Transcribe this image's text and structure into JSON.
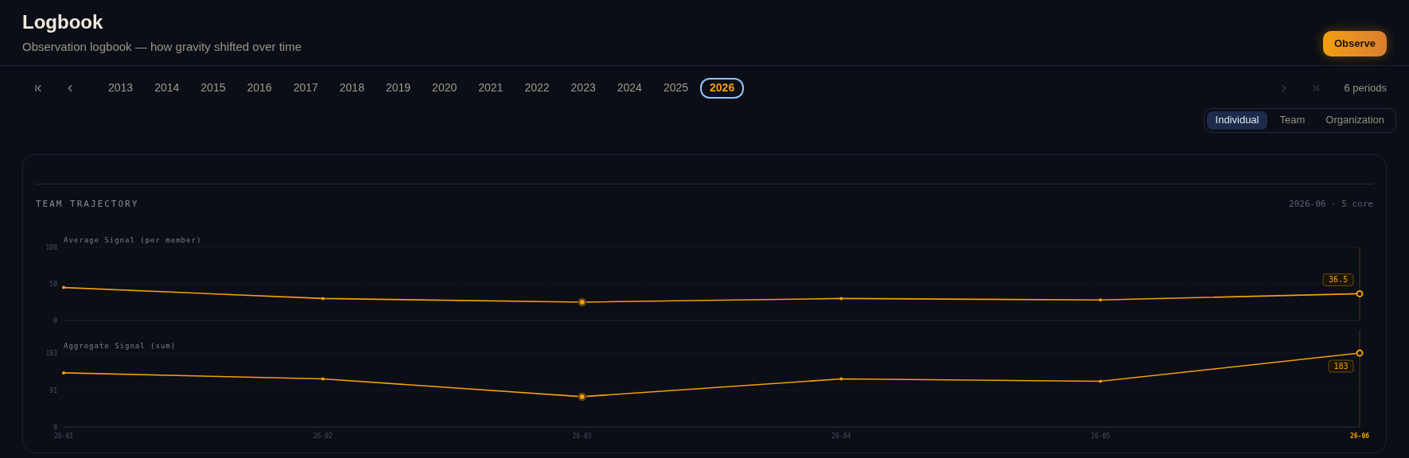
{
  "header": {
    "title": "Logbook",
    "subtitle": "Observation logbook — how gravity shifted over time",
    "action": "Observe"
  },
  "period_nav": {
    "back": [
      {
        "kind": "first",
        "disabled": false
      },
      {
        "kind": "prev",
        "disabled": false
      }
    ],
    "years": [
      {
        "label": "2013",
        "selected": false
      },
      {
        "label": "2014",
        "selected": false
      },
      {
        "label": "2015",
        "selected": false
      },
      {
        "label": "2016",
        "selected": false
      },
      {
        "label": "2017",
        "selected": false
      },
      {
        "label": "2018",
        "selected": false
      },
      {
        "label": "2019",
        "selected": false
      },
      {
        "label": "2020",
        "selected": false
      },
      {
        "label": "2021",
        "selected": false
      },
      {
        "label": "2022",
        "selected": false
      },
      {
        "label": "2023",
        "selected": false
      },
      {
        "label": "2024",
        "selected": false
      },
      {
        "label": "2025",
        "selected": false
      },
      {
        "label": "2026",
        "selected": true
      }
    ],
    "forward": [
      {
        "kind": "next",
        "disabled": true
      },
      {
        "kind": "last",
        "disabled": true
      }
    ],
    "count": "6 periods"
  },
  "views": [
    {
      "label": "Individual",
      "selected": true
    },
    {
      "label": "Team",
      "selected": false
    },
    {
      "label": "Organization",
      "selected": false
    }
  ],
  "card": {
    "title": "TEAM TRAJECTORY",
    "meta": "2026-06 · 5 core",
    "charts": [
      {
        "chart_data": {
          "type": "line",
          "title": "Average Signal (per member)",
          "ylim": [
            0,
            100
          ],
          "yticks": [
            0,
            50,
            100
          ],
          "series": [
            {
              "color": "#f59e0b",
              "values": [
                45,
                30,
                25,
                30,
                28,
                36.5
              ]
            }
          ],
          "annotations": [
            {
              "y": 36.5,
              "text": "36.5"
            }
          ]
        }
      },
      {
        "chart_data": {
          "type": "line",
          "title": "Aggregate Signal (sum)",
          "ylim": [
            0,
            183
          ],
          "yticks": [
            0,
            91,
            183
          ],
          "categories": [
            "26-01",
            "26-02",
            "26-03",
            "26-04",
            "26-05",
            "26-06"
          ],
          "series": [
            {
              "color": "#f59e0b",
              "values": [
                134,
                119,
                75,
                119,
                113,
                183
              ]
            }
          ],
          "annotations": [
            {
              "y": 183,
              "text": "183"
            }
          ]
        }
      }
    ]
  }
}
